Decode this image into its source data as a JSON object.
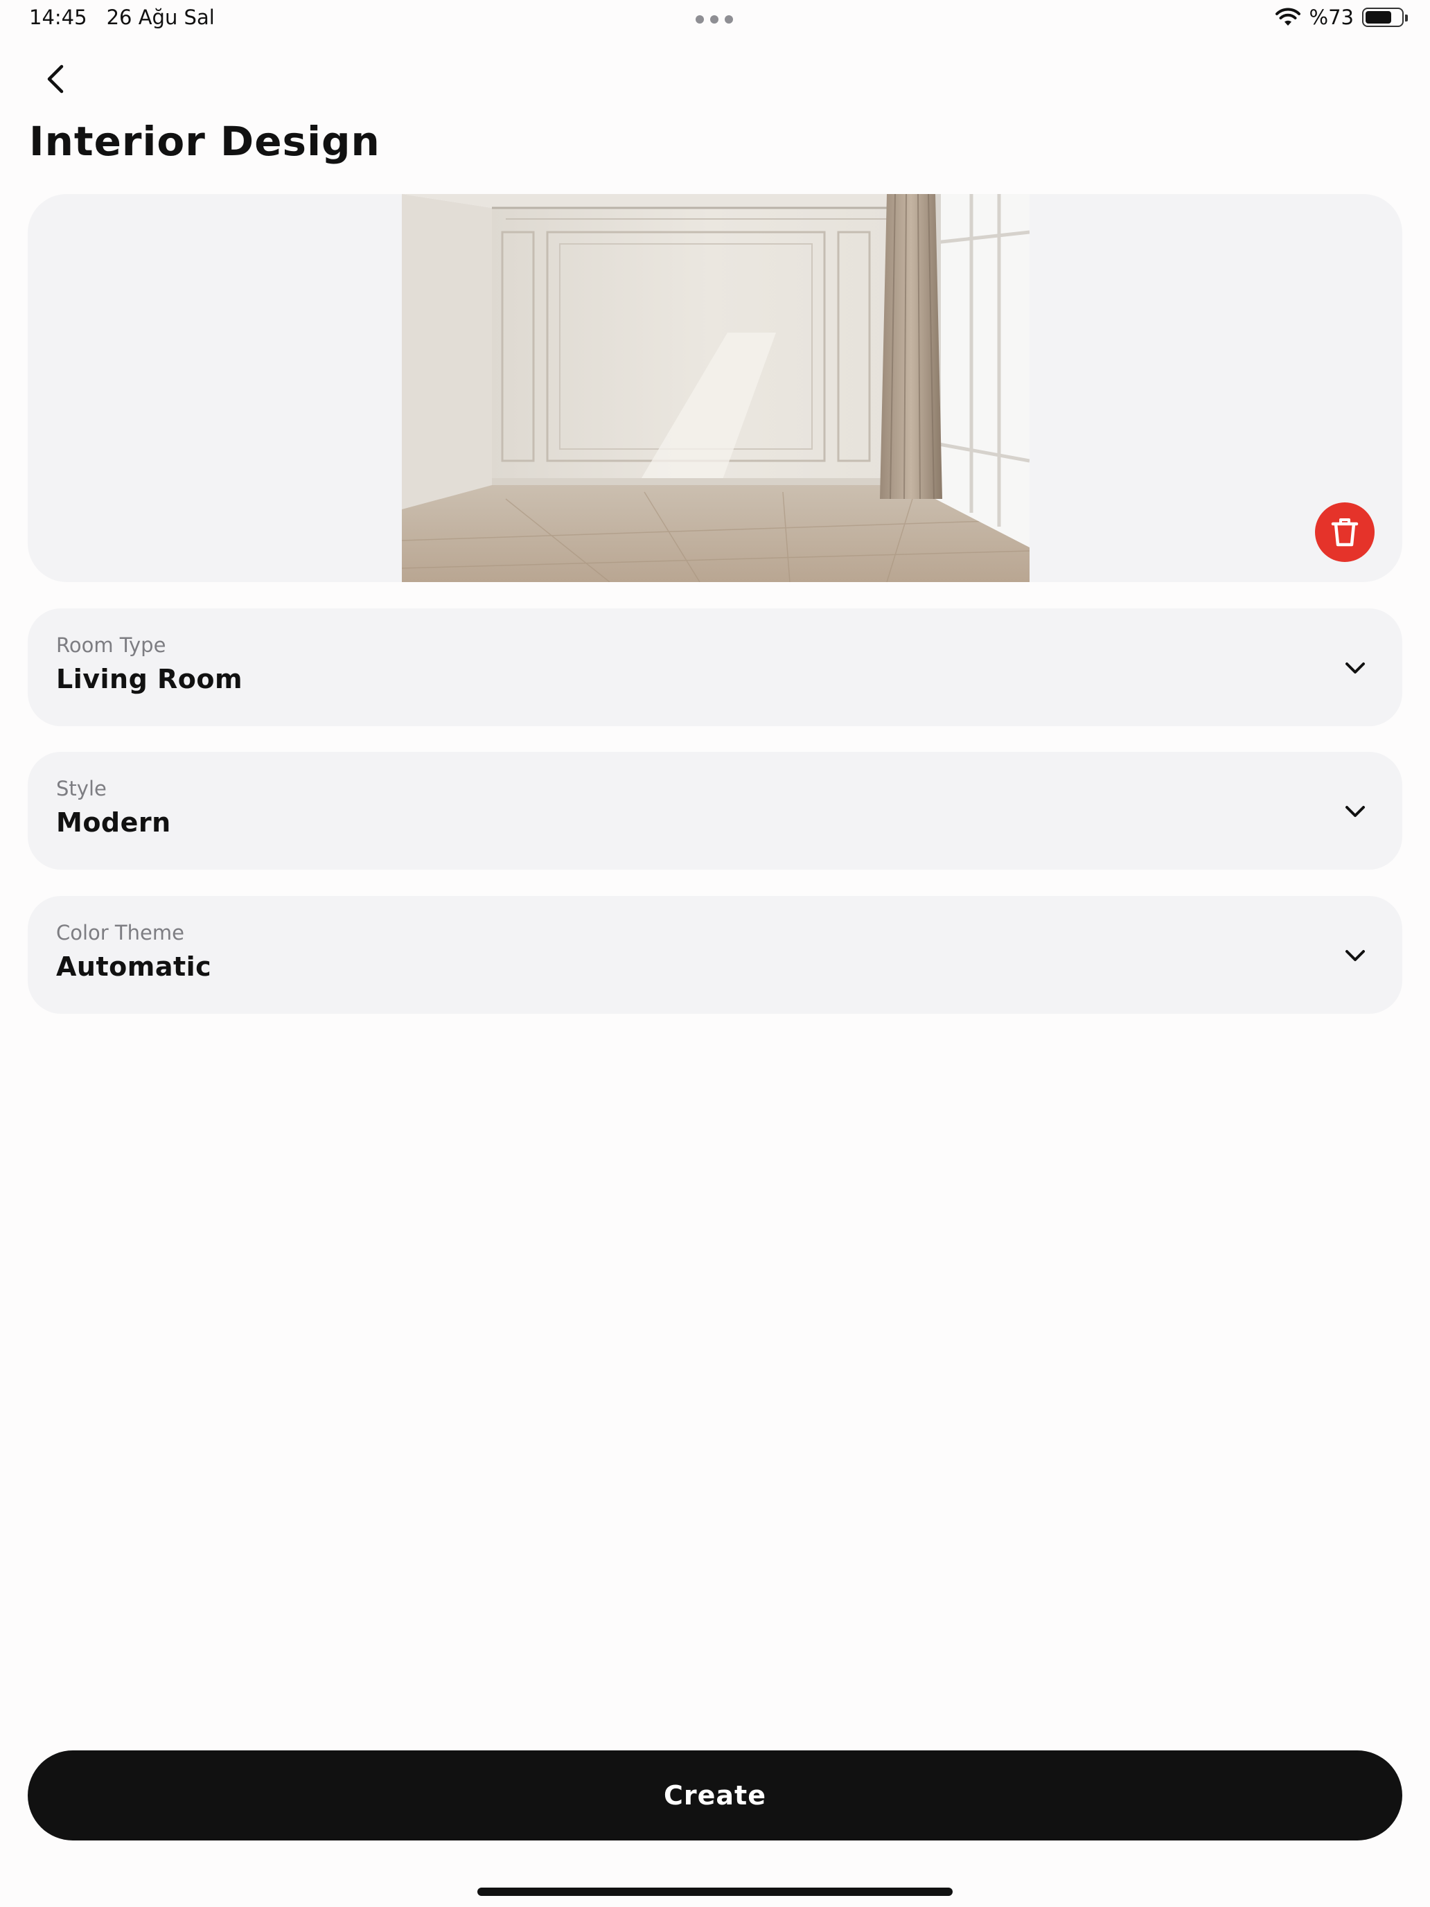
{
  "status_bar": {
    "time": "14:45",
    "date": "26 Ağu Sal",
    "battery_label": "%73",
    "battery_level": 0.73
  },
  "header": {
    "back_icon": "chevron-left-icon",
    "title": "Interior Design"
  },
  "image_card": {
    "delete_icon": "trash-icon",
    "delete_color": "#e5332a"
  },
  "fields": {
    "room_type": {
      "label": "Room Type",
      "value": "Living Room"
    },
    "style": {
      "label": "Style",
      "value": "Modern"
    },
    "color_theme": {
      "label": "Color Theme",
      "value": "Automatic"
    }
  },
  "create_button": {
    "label": "Create",
    "color": "#111111"
  }
}
